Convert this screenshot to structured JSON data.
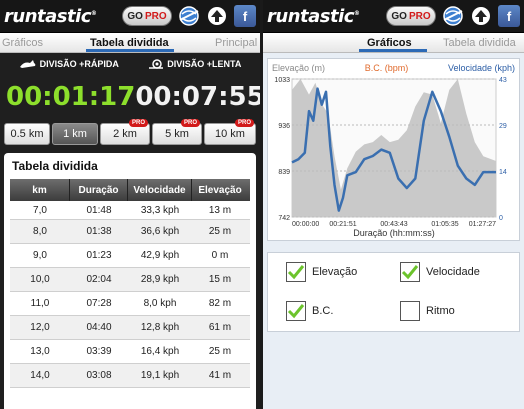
{
  "app": {
    "logo_text": "runtastic",
    "logo_mark": "®",
    "gopro_go": "GO",
    "gopro_pro": "PRO",
    "facebook_letter": "f"
  },
  "left": {
    "tabs": {
      "left": "Gráficos",
      "active": "Tabela dividida",
      "right": "Principal"
    },
    "split": {
      "fast_label": "DIVISÃO +RÁPIDA",
      "slow_label": "DIVISÃO +LENTA",
      "fast_time": "00:01:17",
      "slow_time": "00:07:55"
    },
    "distances": [
      {
        "label": "0.5 km",
        "pro": ""
      },
      {
        "label": "1 km",
        "pro": "",
        "active": true
      },
      {
        "label": "2 km",
        "pro": "PRO"
      },
      {
        "label": "5 km",
        "pro": "PRO"
      },
      {
        "label": "10 km",
        "pro": "PRO"
      }
    ],
    "table": {
      "title": "Tabela dividida",
      "headers": [
        "km",
        "Duração",
        "Velocidade",
        "Elevação"
      ],
      "rows": [
        [
          "7,0",
          "01:48",
          "33,3 kph",
          "13 m"
        ],
        [
          "8,0",
          "01:38",
          "36,6 kph",
          "25 m"
        ],
        [
          "9,0",
          "01:23",
          "42,9 kph",
          "0 m"
        ],
        [
          "10,0",
          "02:04",
          "28,9 kph",
          "15 m"
        ],
        [
          "11,0",
          "07:28",
          "8,0 kph",
          "82 m"
        ],
        [
          "12,0",
          "04:40",
          "12,8 kph",
          "61 m"
        ],
        [
          "13,0",
          "03:39",
          "16,4 kph",
          "25 m"
        ],
        [
          "14,0",
          "03:08",
          "19,1 kph",
          "41 m"
        ]
      ]
    }
  },
  "right": {
    "tabs": {
      "active": "Gráficos",
      "right": "Tabela dividida"
    },
    "checks": [
      {
        "label": "Elevação",
        "checked": true
      },
      {
        "label": "Velocidade",
        "checked": true
      },
      {
        "label": "B.C.",
        "checked": true
      },
      {
        "label": "Ritmo",
        "checked": false
      }
    ]
  },
  "colors": {
    "accent_green": "#8ddf2c",
    "tab_blue": "#2c6ab6",
    "pro_red": "#d21a1a",
    "elevation_gray": "#c9c9c9",
    "speed_blue": "#3a6fb0",
    "hr_orange": "#e06a2c"
  },
  "icons": {
    "fast_split": "hare-icon",
    "slow_split": "snail-icon",
    "world": "globe-icon",
    "upload": "upload-icon",
    "facebook": "facebook-icon"
  },
  "chart_data": {
    "type": "area",
    "legend": [
      "Elevação (m)",
      "B.C. (bpm)",
      "Velocidade (kph)"
    ],
    "xlabel": "Duração (hh:mm:ss)",
    "x_ticks": [
      "00:00:00",
      "00:21:51",
      "00:43:43",
      "01:05:35",
      "01:27:27"
    ],
    "y_left_ticks": [
      "1033",
      "936",
      "839",
      "742"
    ],
    "y_right_ticks": [
      "43",
      "29",
      "14",
      "0"
    ],
    "y_left_range": [
      742,
      1033
    ],
    "y_right_range": [
      0,
      43
    ],
    "x_range_minutes": [
      0,
      96
    ],
    "series": [
      {
        "name": "Elevação (m)",
        "x_minutes": [
          0,
          4,
          8,
          11,
          14,
          17,
          20,
          23,
          26,
          30,
          34,
          38,
          42,
          46,
          50,
          54,
          58,
          62,
          66,
          70,
          74,
          78,
          82,
          86,
          90,
          96
        ],
        "values": [
          1010,
          1033,
          1000,
          1025,
          980,
          960,
          870,
          800,
          845,
          880,
          895,
          900,
          915,
          900,
          905,
          925,
          975,
          1005,
          1000,
          940,
          1010,
          1033,
          960,
          900,
          870,
          860
        ]
      },
      {
        "name": "Velocidade (kph)",
        "x_minutes": [
          0,
          3,
          6,
          8,
          10,
          12,
          14,
          16,
          18,
          20,
          22,
          24,
          26,
          30,
          34,
          38,
          42,
          46,
          50,
          54,
          58,
          62,
          66,
          70,
          74,
          78,
          82,
          86,
          90,
          96
        ],
        "values": [
          17,
          18,
          20,
          33,
          30,
          40,
          35,
          39,
          22,
          10,
          2,
          6,
          13,
          14,
          18,
          19,
          21,
          20,
          12,
          9,
          12,
          30,
          39,
          33,
          25,
          16,
          12,
          10,
          14,
          14
        ]
      }
    ]
  }
}
